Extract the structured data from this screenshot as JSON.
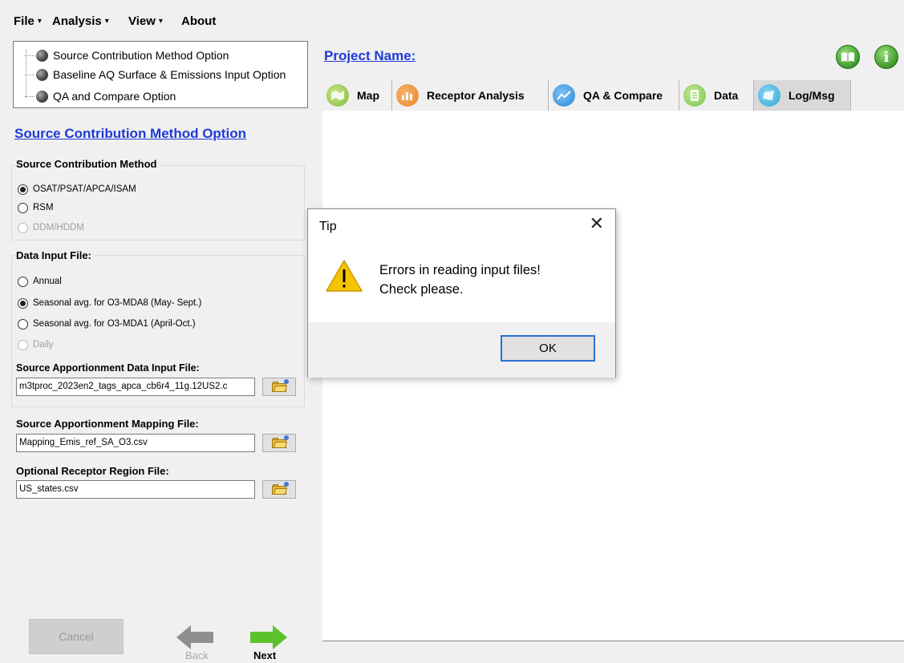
{
  "menu": [
    {
      "label": "File",
      "caret": "▾"
    },
    {
      "label": "Analysis",
      "caret": "▾"
    },
    {
      "label": "View",
      "caret": "▾"
    },
    {
      "label": "About",
      "caret": ""
    }
  ],
  "option_tree": [
    "Source Contribution Method Option",
    "Baseline AQ Surface & Emissions Input Option",
    "QA and Compare Option"
  ],
  "left_panel": {
    "title": "Source Contribution Method Option",
    "method_group": {
      "title": "Source Contribution Method",
      "options": [
        {
          "label": "OSAT/PSAT/APCA/ISAM",
          "checked": true,
          "disabled": false
        },
        {
          "label": "RSM",
          "checked": false,
          "disabled": false
        },
        {
          "label": "DDM/HDDM",
          "checked": false,
          "disabled": true
        }
      ]
    },
    "data_group": {
      "title": "Data Input File:",
      "options": [
        {
          "label": "Annual",
          "checked": false,
          "disabled": false
        },
        {
          "label": "Seasonal avg. for O3-MDA8 (May- Sept.)",
          "checked": true,
          "disabled": false
        },
        {
          "label": "Seasonal avg. for O3-MDA1 (April-Oct.)",
          "checked": false,
          "disabled": false
        },
        {
          "label": "Daily",
          "checked": false,
          "disabled": true
        }
      ],
      "sa_file_label": "Source Apportionment Data Input File:",
      "sa_file_value": "m3tproc_2023en2_tags_apca_cb6r4_11g.12US2.c"
    },
    "mapping_file_label": "Source Apportionment Mapping File:",
    "mapping_file_value": "Mapping_Emis_ref_SA_O3.csv",
    "region_file_label": "Optional Receptor Region File:",
    "region_file_value": "US_states.csv",
    "cancel_label": "Cancel",
    "back_label": "Back",
    "next_label": "Next"
  },
  "right_panel": {
    "project_label": "Project Name:",
    "tabs": [
      {
        "label": "Map",
        "icon": "map-icon",
        "color": "#7fb83a",
        "active": false
      },
      {
        "label": "Receptor Analysis",
        "icon": "bar-chart-icon",
        "color": "#e8842a",
        "active": false
      },
      {
        "label": "QA & Compare",
        "icon": "line-chart-icon",
        "color": "#2a86d6",
        "active": false
      },
      {
        "label": "Data",
        "icon": "document-icon",
        "color": "#7cc24a",
        "active": false
      },
      {
        "label": "Log/Msg",
        "icon": "log-icon",
        "color": "#2aa4d6",
        "active": true
      }
    ]
  },
  "dialog": {
    "title": "Tip",
    "close_glyph": "✕",
    "message_line1": "Errors in reading input files!",
    "message_line2": "Check please.",
    "ok_label": "OK"
  },
  "colors": {
    "link_blue": "#1f3bd6",
    "green_button": "#3c9a2a",
    "warning_yellow": "#f6c400"
  }
}
